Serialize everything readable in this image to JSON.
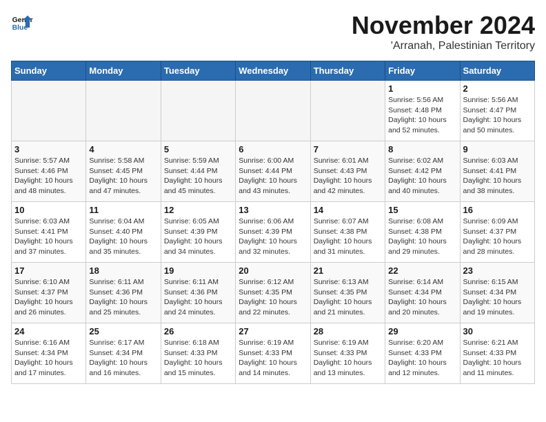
{
  "header": {
    "logo_line1": "General",
    "logo_line2": "Blue",
    "month": "November 2024",
    "location": "'Arranah, Palestinian Territory"
  },
  "weekdays": [
    "Sunday",
    "Monday",
    "Tuesday",
    "Wednesday",
    "Thursday",
    "Friday",
    "Saturday"
  ],
  "weeks": [
    [
      {
        "day": "",
        "empty": true
      },
      {
        "day": "",
        "empty": true
      },
      {
        "day": "",
        "empty": true
      },
      {
        "day": "",
        "empty": true
      },
      {
        "day": "",
        "empty": true
      },
      {
        "day": "1",
        "sunrise": "Sunrise: 5:56 AM",
        "sunset": "Sunset: 4:48 PM",
        "daylight": "Daylight: 10 hours and 52 minutes."
      },
      {
        "day": "2",
        "sunrise": "Sunrise: 5:56 AM",
        "sunset": "Sunset: 4:47 PM",
        "daylight": "Daylight: 10 hours and 50 minutes."
      }
    ],
    [
      {
        "day": "3",
        "sunrise": "Sunrise: 5:57 AM",
        "sunset": "Sunset: 4:46 PM",
        "daylight": "Daylight: 10 hours and 48 minutes."
      },
      {
        "day": "4",
        "sunrise": "Sunrise: 5:58 AM",
        "sunset": "Sunset: 4:45 PM",
        "daylight": "Daylight: 10 hours and 47 minutes."
      },
      {
        "day": "5",
        "sunrise": "Sunrise: 5:59 AM",
        "sunset": "Sunset: 4:44 PM",
        "daylight": "Daylight: 10 hours and 45 minutes."
      },
      {
        "day": "6",
        "sunrise": "Sunrise: 6:00 AM",
        "sunset": "Sunset: 4:44 PM",
        "daylight": "Daylight: 10 hours and 43 minutes."
      },
      {
        "day": "7",
        "sunrise": "Sunrise: 6:01 AM",
        "sunset": "Sunset: 4:43 PM",
        "daylight": "Daylight: 10 hours and 42 minutes."
      },
      {
        "day": "8",
        "sunrise": "Sunrise: 6:02 AM",
        "sunset": "Sunset: 4:42 PM",
        "daylight": "Daylight: 10 hours and 40 minutes."
      },
      {
        "day": "9",
        "sunrise": "Sunrise: 6:03 AM",
        "sunset": "Sunset: 4:41 PM",
        "daylight": "Daylight: 10 hours and 38 minutes."
      }
    ],
    [
      {
        "day": "10",
        "sunrise": "Sunrise: 6:03 AM",
        "sunset": "Sunset: 4:41 PM",
        "daylight": "Daylight: 10 hours and 37 minutes."
      },
      {
        "day": "11",
        "sunrise": "Sunrise: 6:04 AM",
        "sunset": "Sunset: 4:40 PM",
        "daylight": "Daylight: 10 hours and 35 minutes."
      },
      {
        "day": "12",
        "sunrise": "Sunrise: 6:05 AM",
        "sunset": "Sunset: 4:39 PM",
        "daylight": "Daylight: 10 hours and 34 minutes."
      },
      {
        "day": "13",
        "sunrise": "Sunrise: 6:06 AM",
        "sunset": "Sunset: 4:39 PM",
        "daylight": "Daylight: 10 hours and 32 minutes."
      },
      {
        "day": "14",
        "sunrise": "Sunrise: 6:07 AM",
        "sunset": "Sunset: 4:38 PM",
        "daylight": "Daylight: 10 hours and 31 minutes."
      },
      {
        "day": "15",
        "sunrise": "Sunrise: 6:08 AM",
        "sunset": "Sunset: 4:38 PM",
        "daylight": "Daylight: 10 hours and 29 minutes."
      },
      {
        "day": "16",
        "sunrise": "Sunrise: 6:09 AM",
        "sunset": "Sunset: 4:37 PM",
        "daylight": "Daylight: 10 hours and 28 minutes."
      }
    ],
    [
      {
        "day": "17",
        "sunrise": "Sunrise: 6:10 AM",
        "sunset": "Sunset: 4:37 PM",
        "daylight": "Daylight: 10 hours and 26 minutes."
      },
      {
        "day": "18",
        "sunrise": "Sunrise: 6:11 AM",
        "sunset": "Sunset: 4:36 PM",
        "daylight": "Daylight: 10 hours and 25 minutes."
      },
      {
        "day": "19",
        "sunrise": "Sunrise: 6:11 AM",
        "sunset": "Sunset: 4:36 PM",
        "daylight": "Daylight: 10 hours and 24 minutes."
      },
      {
        "day": "20",
        "sunrise": "Sunrise: 6:12 AM",
        "sunset": "Sunset: 4:35 PM",
        "daylight": "Daylight: 10 hours and 22 minutes."
      },
      {
        "day": "21",
        "sunrise": "Sunrise: 6:13 AM",
        "sunset": "Sunset: 4:35 PM",
        "daylight": "Daylight: 10 hours and 21 minutes."
      },
      {
        "day": "22",
        "sunrise": "Sunrise: 6:14 AM",
        "sunset": "Sunset: 4:34 PM",
        "daylight": "Daylight: 10 hours and 20 minutes."
      },
      {
        "day": "23",
        "sunrise": "Sunrise: 6:15 AM",
        "sunset": "Sunset: 4:34 PM",
        "daylight": "Daylight: 10 hours and 19 minutes."
      }
    ],
    [
      {
        "day": "24",
        "sunrise": "Sunrise: 6:16 AM",
        "sunset": "Sunset: 4:34 PM",
        "daylight": "Daylight: 10 hours and 17 minutes."
      },
      {
        "day": "25",
        "sunrise": "Sunrise: 6:17 AM",
        "sunset": "Sunset: 4:34 PM",
        "daylight": "Daylight: 10 hours and 16 minutes."
      },
      {
        "day": "26",
        "sunrise": "Sunrise: 6:18 AM",
        "sunset": "Sunset: 4:33 PM",
        "daylight": "Daylight: 10 hours and 15 minutes."
      },
      {
        "day": "27",
        "sunrise": "Sunrise: 6:19 AM",
        "sunset": "Sunset: 4:33 PM",
        "daylight": "Daylight: 10 hours and 14 minutes."
      },
      {
        "day": "28",
        "sunrise": "Sunrise: 6:19 AM",
        "sunset": "Sunset: 4:33 PM",
        "daylight": "Daylight: 10 hours and 13 minutes."
      },
      {
        "day": "29",
        "sunrise": "Sunrise: 6:20 AM",
        "sunset": "Sunset: 4:33 PM",
        "daylight": "Daylight: 10 hours and 12 minutes."
      },
      {
        "day": "30",
        "sunrise": "Sunrise: 6:21 AM",
        "sunset": "Sunset: 4:33 PM",
        "daylight": "Daylight: 10 hours and 11 minutes."
      }
    ]
  ]
}
